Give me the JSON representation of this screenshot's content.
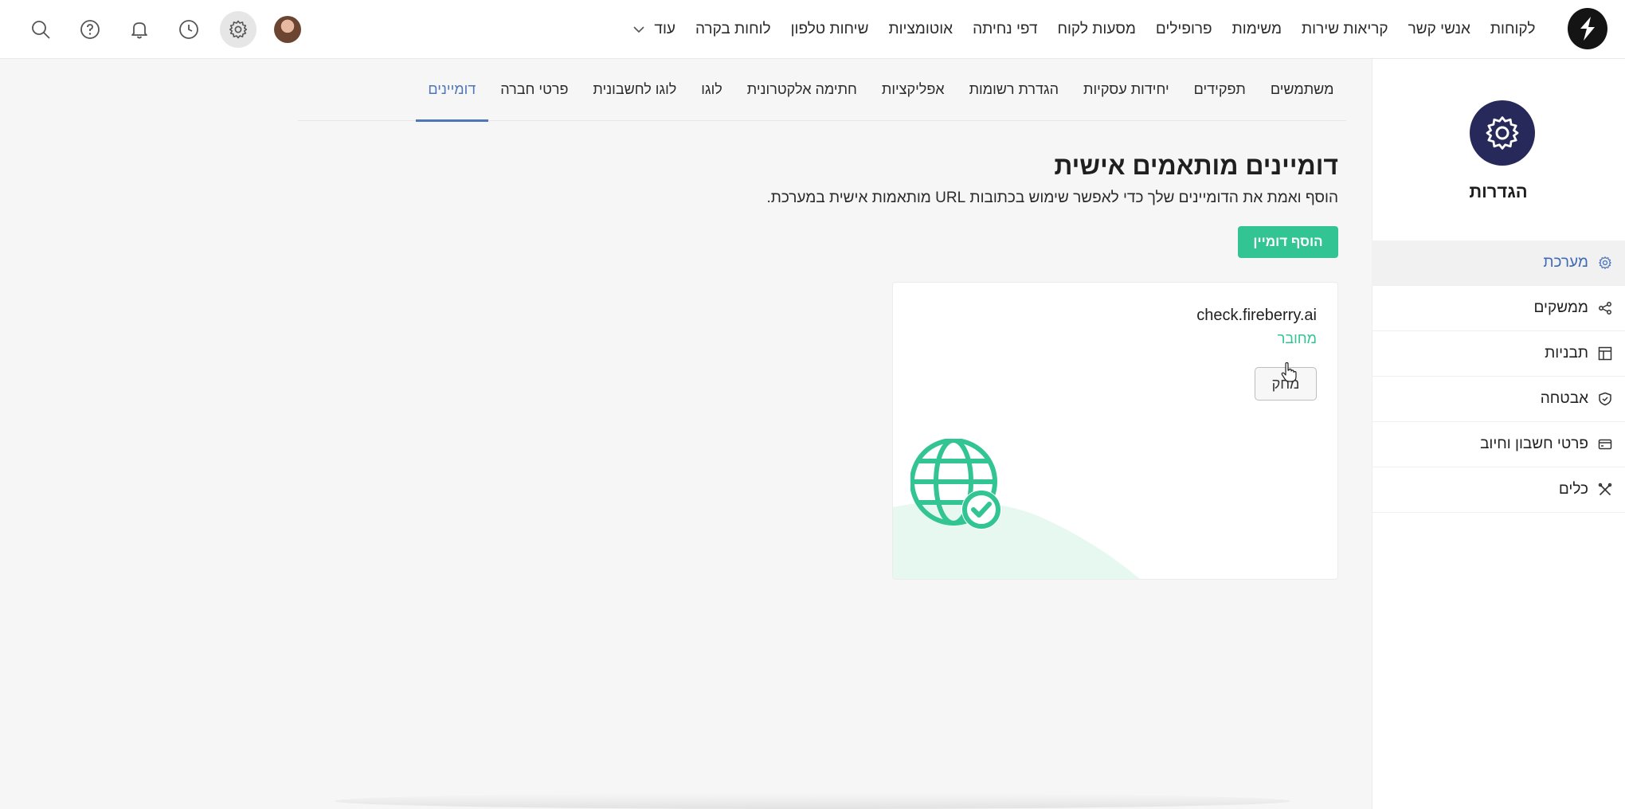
{
  "topnav": {
    "items": [
      {
        "label": "לקוחות"
      },
      {
        "label": "אנשי קשר"
      },
      {
        "label": "קריאות שירות"
      },
      {
        "label": "משימות"
      },
      {
        "label": "פרופילים"
      },
      {
        "label": "מסעות לקוח"
      },
      {
        "label": "דפי נחיתה"
      },
      {
        "label": "אוטומציות"
      },
      {
        "label": "שיחות טלפון"
      },
      {
        "label": "לוחות בקרה"
      }
    ],
    "more_label": "עוד"
  },
  "top_icons": [
    "search-icon",
    "help-icon",
    "bell-icon",
    "clock-icon",
    "gear-icon",
    "avatar"
  ],
  "sidebar": {
    "title": "הגדרות",
    "items": [
      {
        "label": "מערכת",
        "icon": "gear-icon"
      },
      {
        "label": "ממשקים",
        "icon": "share-icon"
      },
      {
        "label": "תבניות",
        "icon": "layout-icon"
      },
      {
        "label": "אבטחה",
        "icon": "shield-icon"
      },
      {
        "label": "פרטי חשבון וחיוב",
        "icon": "credit-card-icon"
      },
      {
        "label": "כלים",
        "icon": "tools-icon"
      }
    ]
  },
  "tabs": [
    {
      "label": "משתמשים"
    },
    {
      "label": "תפקידים"
    },
    {
      "label": "יחידות עסקיות"
    },
    {
      "label": "הגדרת רשומות"
    },
    {
      "label": "אפליקציות"
    },
    {
      "label": "חתימה אלקטרונית"
    },
    {
      "label": "לוגו"
    },
    {
      "label": "לוגו לחשבונית"
    },
    {
      "label": "פרטי חברה"
    },
    {
      "label": "דומיינים"
    }
  ],
  "main": {
    "title": "דומיינים מותאמים אישית",
    "subtitle": "הוסף ואמת את הדומיינים שלך כדי לאפשר שימוש בכתובות URL מותאמות אישית במערכת.",
    "add_button": "הוסף דומיין",
    "card": {
      "domain": "check.fireberry.ai",
      "status": "מחובר",
      "delete_button": "מחק"
    }
  },
  "colors": {
    "accent_green": "#33c493",
    "accent_blue": "#4e76b8",
    "sidebar_badge": "#27295a"
  }
}
